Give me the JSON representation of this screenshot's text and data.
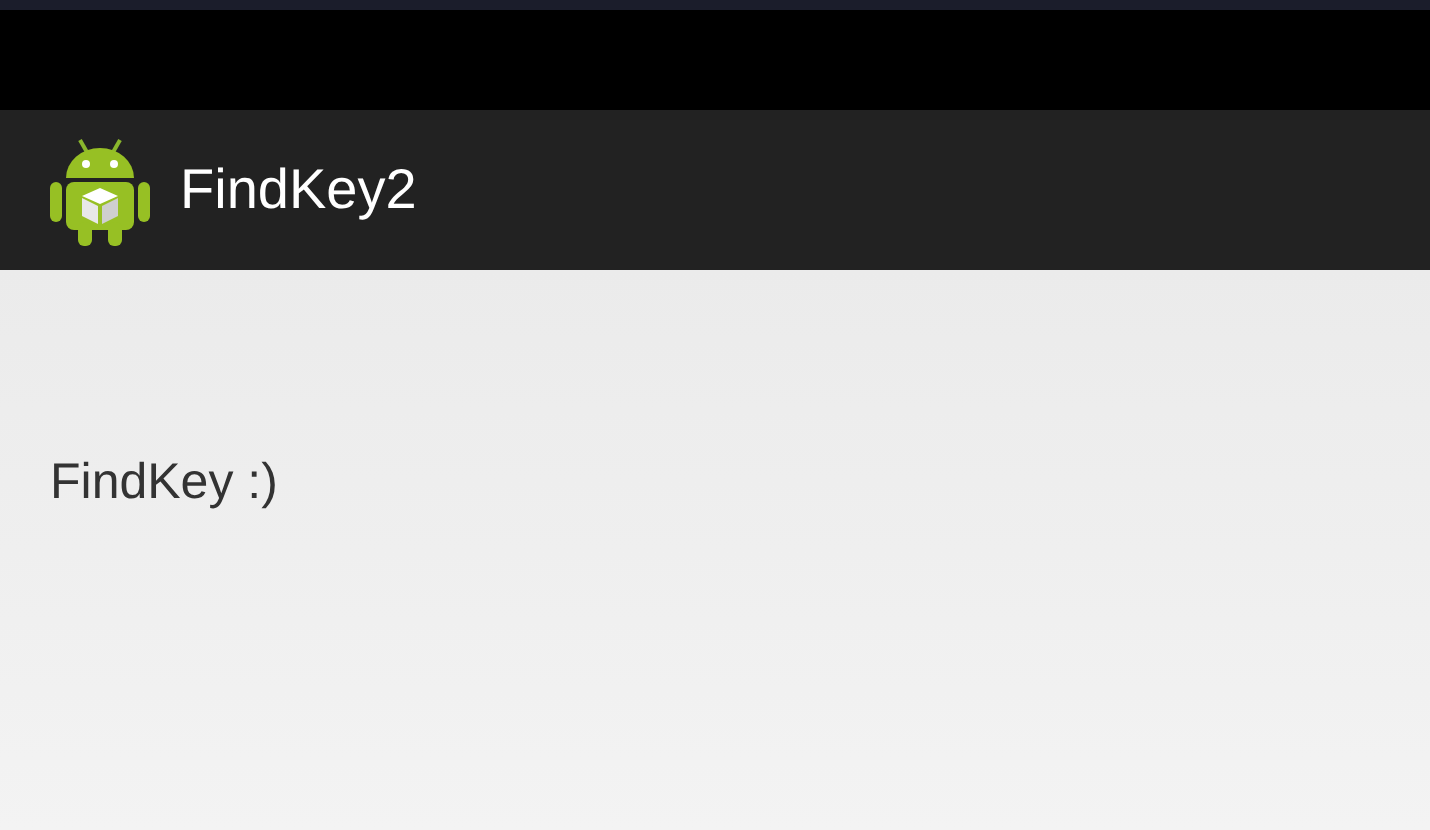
{
  "action_bar": {
    "title": "FindKey2"
  },
  "content": {
    "text": "FindKey :)"
  }
}
